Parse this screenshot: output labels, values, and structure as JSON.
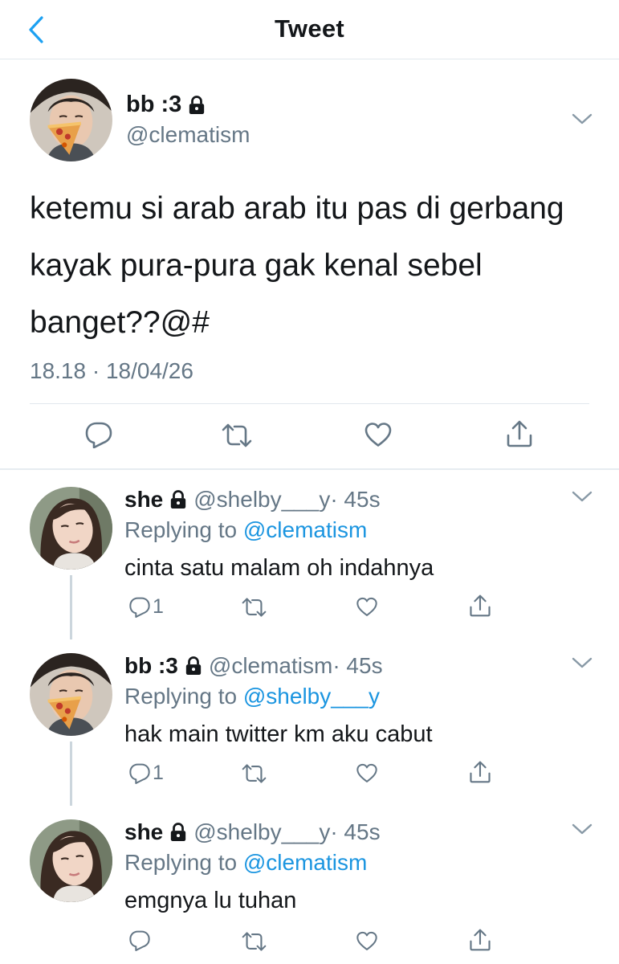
{
  "header": {
    "title": "Tweet"
  },
  "main_tweet": {
    "name": "bb :3",
    "handle": "@clematism",
    "text_lines": [
      "ketemu si arab arab itu pas di gerbang",
      "kayak pura-pura gak kenal sebel",
      "banget??@#"
    ],
    "meta": "18.18 · 18/04/26"
  },
  "replies": [
    {
      "name": "she",
      "handle": "@shelby___y",
      "time": " · 45s",
      "replying_prefix": "Replying to ",
      "replying_to": "@clematism",
      "text": "cinta satu malam oh indahnya",
      "reply_count": "1"
    },
    {
      "name": "bb :3",
      "handle": "@clematism",
      "time": " · 45s",
      "replying_prefix": "Replying to ",
      "replying_to": "@shelby___y",
      "text": "hak main twitter km aku cabut",
      "reply_count": "1"
    },
    {
      "name": "she",
      "handle": "@shelby___y",
      "time": " · 45s",
      "replying_prefix": "Replying to ",
      "replying_to": "@clematism",
      "text": "emgnya lu tuhan",
      "reply_count": ""
    }
  ],
  "icons": {
    "back": "chevron-left-icon",
    "lock": "lock-icon",
    "caret": "chevron-down-icon",
    "reply": "speech-bubble-icon",
    "retweet": "retweet-icon",
    "like": "heart-icon",
    "share": "share-icon"
  },
  "colors": {
    "accent": "#1da1f2",
    "link": "#1b95e0",
    "text": "#14171a",
    "secondary": "#657786",
    "divider": "#e1e8ed"
  }
}
